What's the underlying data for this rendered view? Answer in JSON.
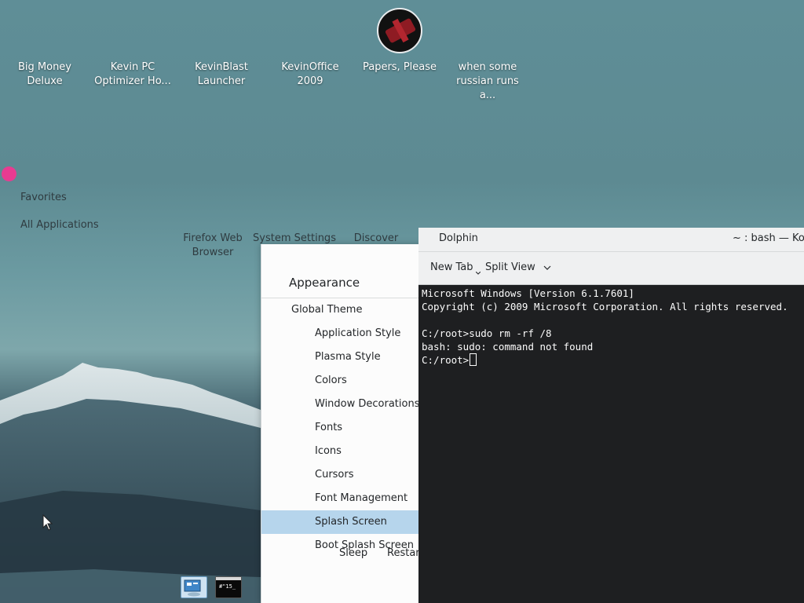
{
  "desktop": {
    "icons": [
      {
        "label": "Big Money Deluxe"
      },
      {
        "label": "Kevin PC Optimizer Ho..."
      },
      {
        "label": "KevinBlast Launcher"
      },
      {
        "label": "KevinOffice 2009"
      },
      {
        "label": "Papers, Please"
      },
      {
        "label": "when some russian runs a..."
      }
    ]
  },
  "launcher": {
    "categories": [
      "Favorites",
      "All Applications"
    ],
    "favorites": [
      "Firefox Web Browser",
      "System Settings",
      "Discover"
    ],
    "power": [
      "Sleep",
      "Restart"
    ]
  },
  "settings": {
    "title": "Appearance",
    "items": [
      {
        "label": "Global Theme"
      },
      {
        "label": "Application Style"
      },
      {
        "label": "Plasma Style"
      },
      {
        "label": "Colors"
      },
      {
        "label": "Window Decorations"
      },
      {
        "label": "Fonts"
      },
      {
        "label": "Icons"
      },
      {
        "label": "Cursors"
      },
      {
        "label": "Font Management"
      },
      {
        "label": "Splash Screen"
      },
      {
        "label": "Boot Splash Screen"
      }
    ],
    "selected": "Splash Screen"
  },
  "window": {
    "title_left": "Dolphin",
    "title_right": "~ : bash — Kon",
    "toolbar": {
      "new_tab": "New Tab",
      "split_view": "Split View"
    },
    "terminal_lines": [
      "Microsoft Windows [Version 6.1.7601]",
      "Copyright (c) 2009 Microsoft Corporation. All rights reserved.",
      "",
      "C:/root>sudo rm -rf /8",
      "bash: sudo: command not found",
      "C:/root>"
    ]
  },
  "colors": {
    "selection": "#b6d5ec",
    "terminal_bg": "#1e1f21",
    "accent_dot": "#e83b91"
  }
}
